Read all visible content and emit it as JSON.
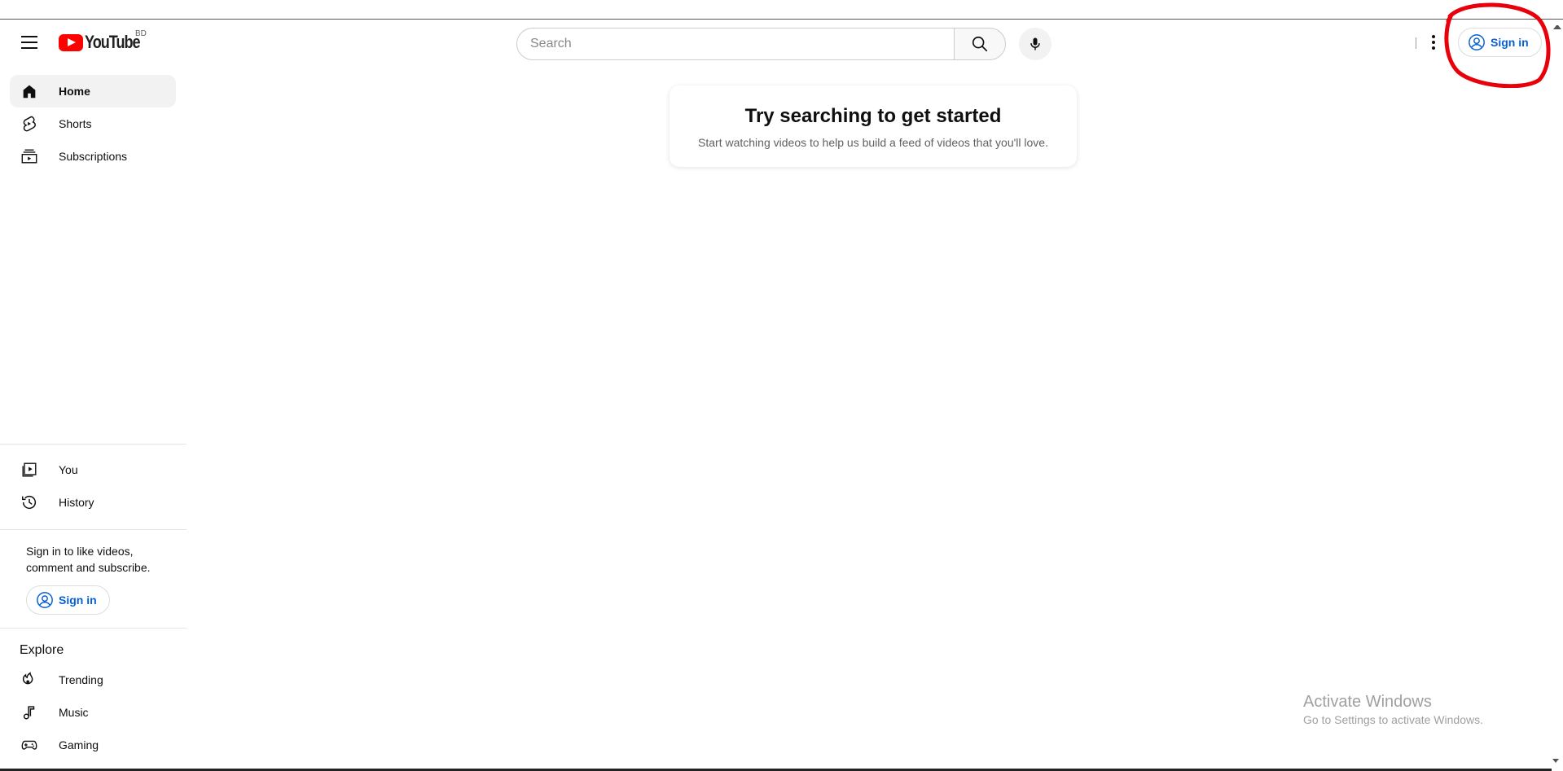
{
  "masthead": {
    "logo_text": "YouTube",
    "country_code": "BD",
    "search_placeholder": "Search",
    "signin_label": "Sign in"
  },
  "sidebar": {
    "primary": [
      {
        "label": "Home",
        "icon": "home-icon",
        "active": true
      },
      {
        "label": "Shorts",
        "icon": "shorts-icon"
      },
      {
        "label": "Subscriptions",
        "icon": "subscriptions-icon"
      }
    ],
    "you": [
      {
        "label": "You",
        "icon": "you-icon"
      },
      {
        "label": "History",
        "icon": "history-icon"
      }
    ],
    "signin_prompt": "Sign in to like videos, comment and subscribe.",
    "signin_label": "Sign in",
    "explore_title": "Explore",
    "explore": [
      {
        "label": "Trending",
        "icon": "trending-icon"
      },
      {
        "label": "Music",
        "icon": "music-icon"
      },
      {
        "label": "Gaming",
        "icon": "gaming-icon"
      }
    ]
  },
  "main": {
    "prompt_title": "Try searching to get started",
    "prompt_subtitle": "Start watching videos to help us build a feed of videos that you'll love."
  },
  "watermark": {
    "title": "Activate Windows",
    "subtitle": "Go to Settings to activate Windows."
  },
  "colors": {
    "brand_red": "#ff0000",
    "link_blue": "#065fd4",
    "annotation_red": "#e8000b"
  }
}
